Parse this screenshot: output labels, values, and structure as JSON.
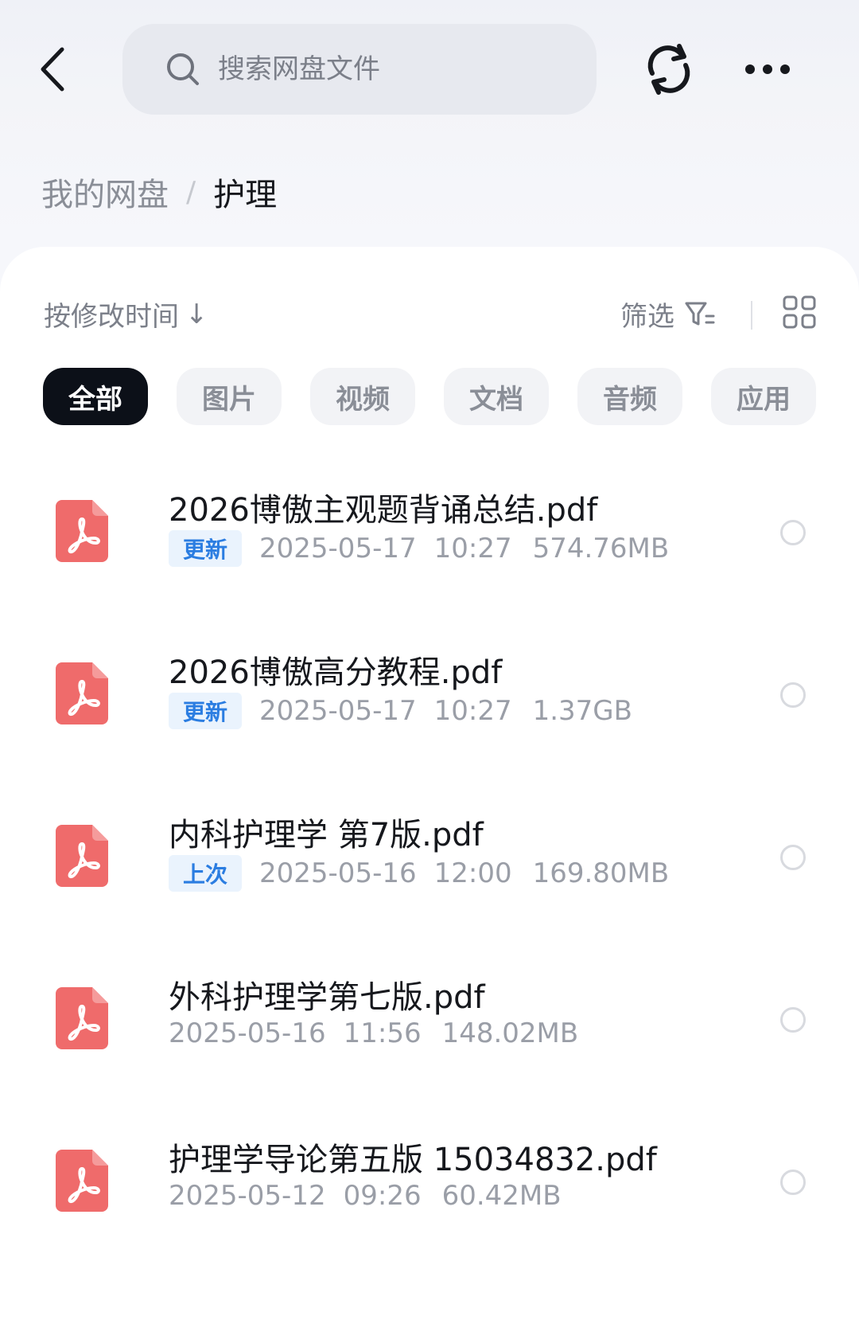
{
  "search": {
    "placeholder": "搜索网盘文件"
  },
  "breadcrumb": {
    "root": "我的网盘",
    "separator": "/",
    "current": "护理"
  },
  "toolbar": {
    "sort_label": "按修改时间",
    "sort_arrow": "↓",
    "filter_label": "筛选"
  },
  "tabs": [
    "全部",
    "图片",
    "视频",
    "文档",
    "音频",
    "应用"
  ],
  "active_tab": "全部",
  "files": [
    {
      "name": "2026博傲主观题背诵总结.pdf",
      "badge": "更新",
      "date": "2025-05-17",
      "time": "10:27",
      "size": "574.76MB"
    },
    {
      "name": "2026博傲高分教程.pdf",
      "badge": "更新",
      "date": "2025-05-17",
      "time": "10:27",
      "size": "1.37GB"
    },
    {
      "name": "内科护理学 第7版.pdf",
      "badge": "上次",
      "date": "2025-05-16",
      "time": "12:00",
      "size": "169.80MB"
    },
    {
      "name": "外科护理学第七版.pdf",
      "badge": "",
      "date": "2025-05-16",
      "time": "11:56",
      "size": "148.02MB"
    },
    {
      "name": "护理学导论第五版 15034832.pdf",
      "badge": "",
      "date": "2025-05-12",
      "time": "09:26",
      "size": "60.42MB"
    }
  ],
  "icons": {
    "back": "chevron-left-icon",
    "search": "search-icon",
    "refresh": "refresh-icon",
    "more": "more-horizontal-icon",
    "filter": "filter-icon",
    "grid": "grid-view-icon",
    "file": "pdf-file-icon"
  },
  "colors": {
    "pdf_icon": "#ef6b6b",
    "badge_bg": "#eaf3fd",
    "badge_text": "#2b7de1",
    "active_tab_bg": "#0c1018"
  }
}
